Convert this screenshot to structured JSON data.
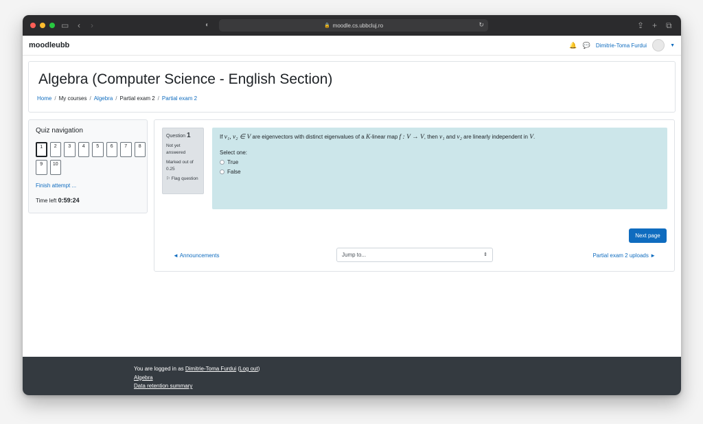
{
  "browser": {
    "url": "moodle.cs.ubbcluj.ro",
    "colors": {
      "close": "#ff5f57",
      "minimize": "#febc2e",
      "zoom": "#28c840"
    }
  },
  "navbar": {
    "brand": "moodleubb",
    "user_name": "Dimitrie-Toma Furdui"
  },
  "header": {
    "title": "Algebra (Computer Science - English Section)",
    "breadcrumb": [
      {
        "label": "Home"
      },
      {
        "label": "My courses"
      },
      {
        "label": "Algebra"
      },
      {
        "label": "Partial exam 2"
      },
      {
        "label": "Partial exam 2"
      }
    ],
    "separator": "/"
  },
  "quiz_nav": {
    "title": "Quiz navigation",
    "questions": [
      "1",
      "2",
      "3",
      "4",
      "5",
      "6",
      "7",
      "8",
      "9",
      "10"
    ],
    "current": "1",
    "finish_label": "Finish attempt ...",
    "time_left_label": "Time left",
    "time_left": "0:59:24"
  },
  "question": {
    "label": "Question",
    "number": "1",
    "status": "Not yet answered",
    "marked": "Marked out of 0.25",
    "flag": "Flag question",
    "text_parts": {
      "p1": "If ",
      "m1": "v₁, v₂ ∈ V",
      "p2": " are eigenvectors with distinct eigenvalues of a ",
      "m2": "K",
      "p3": "-linear map ",
      "m3": "f : V → V",
      "p4": ", then ",
      "m4": "v₁",
      "p5": " and ",
      "m5": "v₂",
      "p6": " are linearly independent in ",
      "m6": "V",
      "p7": "."
    },
    "select_label": "Select one:",
    "options": [
      "True",
      "False"
    ]
  },
  "actions": {
    "next_page": "Next page",
    "prev_link": "◄ Announcements",
    "jump_placeholder": "Jump to...",
    "next_link": "Partial exam 2 uploads ►"
  },
  "footer": {
    "logged_in_prefix": "You are logged in as ",
    "user_name": "Dimitrie-Toma Furdui",
    "logout": "Log out",
    "course": "Algebra",
    "data_retention": "Data retention summary"
  }
}
